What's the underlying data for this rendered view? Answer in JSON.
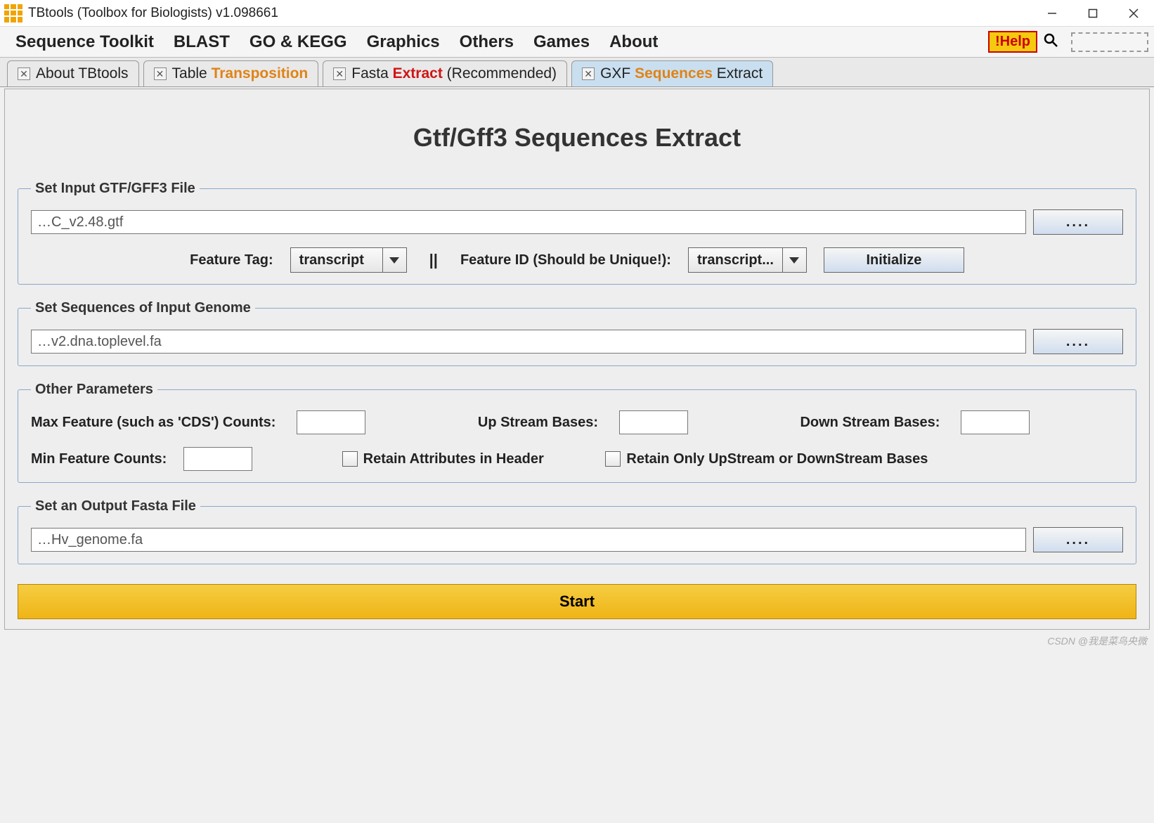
{
  "window": {
    "title": "TBtools (Toolbox for Biologists) v1.098661"
  },
  "menu": {
    "items": [
      "Sequence Toolkit",
      "BLAST",
      "GO & KEGG",
      "Graphics",
      "Others",
      "Games",
      "About"
    ],
    "help_label": "!Help"
  },
  "tabs": [
    {
      "prefix": "About TBtools",
      "hl": "",
      "hl_class": "",
      "suffix": "",
      "active": false
    },
    {
      "prefix": "Table ",
      "hl": "Transposition",
      "hl_class": "orange",
      "suffix": "",
      "active": false
    },
    {
      "prefix": "Fasta ",
      "hl": "Extract",
      "hl_class": "red",
      "suffix": " (Recommended)",
      "active": false
    },
    {
      "prefix": "GXF ",
      "hl": "Sequences",
      "hl_class": "orange",
      "suffix": " Extract",
      "active": true
    }
  ],
  "page": {
    "title": "Gtf/Gff3 Sequences Extract"
  },
  "groups": {
    "input_gtf": {
      "legend": "Set Input GTF/GFF3 File",
      "file_value": "…C_v2.48.gtf",
      "browse": "....",
      "feature_tag_label": "Feature Tag:",
      "feature_tag_value": "transcript",
      "feature_id_label": "Feature ID (Should be Unique!):",
      "feature_id_value": "transcript...",
      "divider": "||",
      "initialize": "Initialize"
    },
    "input_genome": {
      "legend": "Set Sequences of Input Genome",
      "file_value": "…v2.dna.toplevel.fa",
      "browse": "...."
    },
    "other": {
      "legend": "Other Parameters",
      "max_feature_label": "Max Feature (such as 'CDS') Counts:",
      "max_feature_value": "",
      "up_stream_label": "Up Stream Bases:",
      "up_stream_value": "",
      "down_stream_label": "Down Stream Bases:",
      "down_stream_value": "",
      "min_feature_label": "Min Feature Counts:",
      "min_feature_value": "",
      "retain_attr_label": "Retain Attributes in Header",
      "retain_only_label": "Retain Only UpStream or DownStream Bases"
    },
    "output": {
      "legend": "Set an Output Fasta File",
      "file_value": "…Hv_genome.fa",
      "browse": "...."
    }
  },
  "start_label": "Start",
  "watermark": "CSDN @我是菜鸟央微"
}
